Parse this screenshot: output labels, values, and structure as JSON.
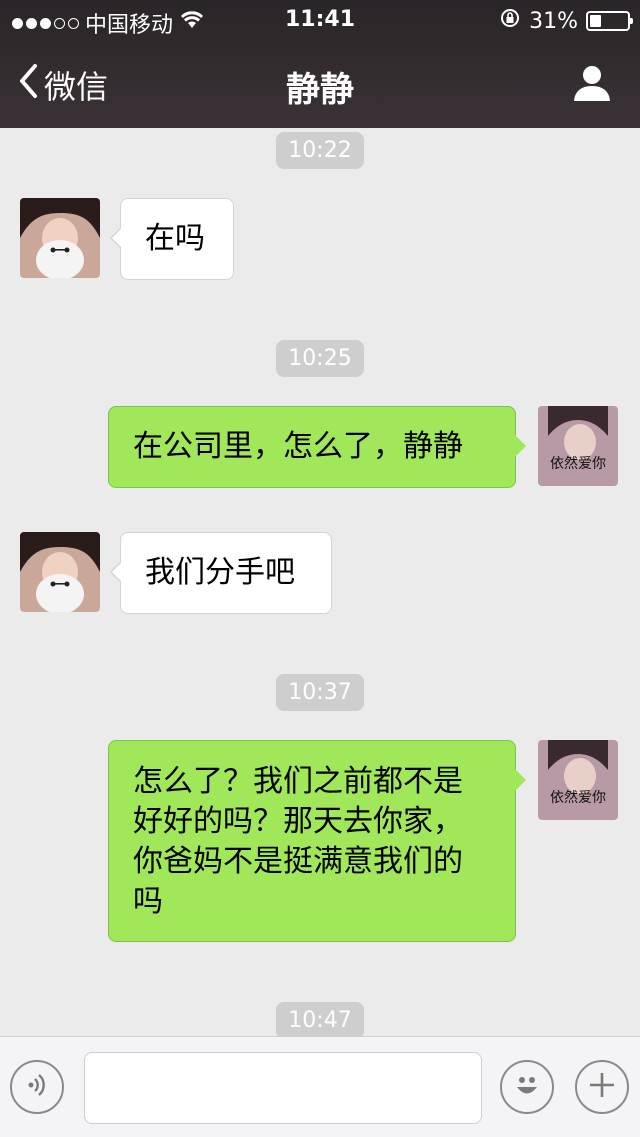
{
  "status_bar": {
    "carrier": "中国移动",
    "time": "11:41",
    "battery_text": "31%",
    "battery_level": 0.31
  },
  "nav": {
    "back_label": "微信",
    "title": "静静"
  },
  "messages": [
    {
      "timestamp": "10:22"
    },
    {
      "side": "left",
      "text": "在吗"
    },
    {
      "timestamp": "10:25"
    },
    {
      "side": "right",
      "text": "在公司里，怎么了，静静",
      "avatar_caption": "依然爱你"
    },
    {
      "side": "left",
      "text": "我们分手吧"
    },
    {
      "timestamp": "10:37"
    },
    {
      "side": "right",
      "lines": [
        "怎么了？我们之前都不是",
        "好好的吗？那天去你家，",
        "你爸妈不是挺满意我们的",
        "吗"
      ],
      "avatar_caption": "依然爱你"
    },
    {
      "timestamp": "10:47"
    }
  ],
  "input_bar": {
    "placeholder": ""
  },
  "colors": {
    "header_bg": "#2f2a2d",
    "chat_bg": "#ebebeb",
    "sent_bubble": "#a0e75a",
    "received_bubble": "#ffffff",
    "timestamp_bg": "#cecece"
  }
}
